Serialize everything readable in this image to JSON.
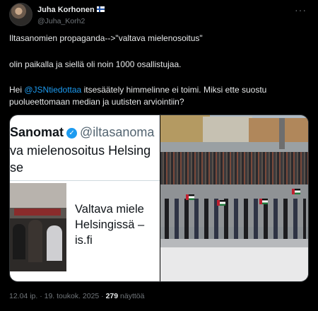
{
  "author": {
    "name": "Juha Korhonen",
    "handle": "@Juha_Korh2",
    "flag": "finland-flag-icon"
  },
  "tweet": {
    "line1": "Iltasanomien propaganda-->\"valtava mielenosoitus\"",
    "line2": "olin paikalla ja siellä oli noin 1000 osallistujaa.",
    "line3_prefix": "Hei ",
    "line3_mention": "@JSNtiedottaa",
    "line3_suffix": " itsesäätely himmelinne ei toimi. Miksi ette suostu",
    "line4": "puolueettomaan median ja uutisten arviointiin?"
  },
  "embedded_screenshot": {
    "account_name": "Sanomat",
    "account_handle": "@iltasanoma",
    "post_line1": "va mielenosoitus Helsing",
    "post_line2": "se",
    "card_title_line1": "Valtava miele",
    "card_title_line2": "Helsingissä –",
    "card_domain": "is.fi"
  },
  "meta": {
    "time_date": "12.04 ip. · 19. toukok. 2025 · ",
    "views_count": "279",
    "views_label": " näyttöä"
  },
  "colors": {
    "background": "#000000",
    "text": "#e7e9ea",
    "muted": "#71767b",
    "link": "#1d9bf0"
  }
}
